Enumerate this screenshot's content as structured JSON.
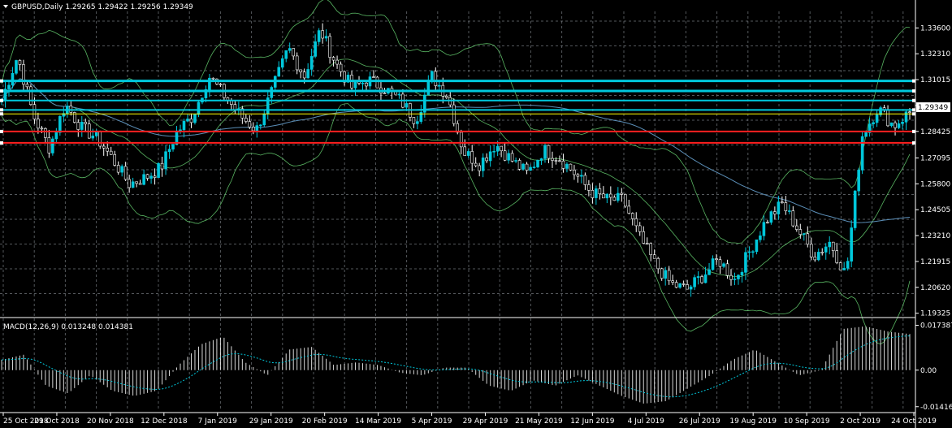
{
  "chart_data": {
    "type": "candlestick",
    "symbol": "GBPUSD,Daily",
    "ohlc_header": "1.29265 1.29422 1.29256 1.29349",
    "current_price": "1.29349",
    "price_axis_ticks": [
      "1.33600",
      "1.32310",
      "1.31015",
      "1.29720",
      "1.28425",
      "1.27095",
      "1.25800",
      "1.24505",
      "1.23210",
      "1.21915",
      "1.20620",
      "1.19325"
    ],
    "price_range": [
      1.1923,
      1.3435
    ],
    "date_labels": [
      "25 Oct 2018",
      "29 Oct 2018",
      "20 Nov 2018",
      "12 Dec 2018",
      "7 Jan 2019",
      "29 Jan 2019",
      "20 Feb 2019",
      "14 Mar 2019",
      "5 Apr 2019",
      "29 Apr 2019",
      "21 May 2019",
      "12 Jun 2019",
      "4 Jul 2019",
      "26 Jul 2019",
      "19 Aug 2019",
      "10 Sep 2019",
      "2 Oct 2019",
      "24 Oct 2019"
    ],
    "price_path": [
      1.3,
      1.322,
      1.292,
      1.276,
      1.298,
      1.286,
      1.281,
      1.27,
      1.258,
      1.261,
      1.266,
      1.284,
      1.292,
      1.312,
      1.302,
      1.292,
      1.285,
      1.305,
      1.326,
      1.312,
      1.335,
      1.318,
      1.306,
      1.31,
      1.306,
      1.3,
      1.29,
      1.312,
      1.302,
      1.274,
      1.268,
      1.278,
      1.27,
      1.263,
      1.275,
      1.271,
      1.263,
      1.254,
      1.25,
      1.25,
      1.232,
      1.218,
      1.208,
      1.205,
      1.212,
      1.22,
      1.21,
      1.225,
      1.24,
      1.248,
      1.235,
      1.222,
      1.229,
      1.212,
      1.282,
      1.296,
      1.287,
      1.294
    ],
    "horizontal_levels": [
      {
        "price": 1.3095,
        "color": "#00c8dc",
        "width": 3
      },
      {
        "price": 1.3045,
        "color": "#00c8dc",
        "width": 3
      },
      {
        "price": 1.2997,
        "color": "#00c8dc",
        "width": 2
      },
      {
        "price": 1.295,
        "color": "#00c8dc",
        "width": 2
      },
      {
        "price": 1.293,
        "color": "#ffff00",
        "width": 1
      },
      {
        "price": 1.2842,
        "color": "#ff2020",
        "width": 2
      },
      {
        "price": 1.2785,
        "color": "#ff2020",
        "width": 2
      }
    ],
    "indicators": {
      "bollinger": "bands (green)",
      "moving_average": "line (steel blue)"
    },
    "macd": {
      "label": "MACD(12,26,9) 0.013248 0.014381",
      "axis_ticks": [
        "0.017387",
        "0.00",
        "-0.014165"
      ],
      "range": [
        -0.0155,
        0.0185
      ],
      "path": [
        0.004,
        0.006,
        -0.006,
        -0.009,
        -0.002,
        -0.008,
        -0.01,
        -0.008,
        0.002,
        0.01,
        0.013,
        0.003,
        -0.002,
        0.008,
        0.009,
        0.002,
        0.003,
        0.002,
        -0.001,
        -0.002,
        0.001,
        0.001,
        -0.006,
        -0.008,
        -0.004,
        -0.006,
        -0.002,
        -0.006,
        -0.01,
        -0.013,
        -0.012,
        -0.007,
        -0.002,
        0.004,
        0.008,
        0.003,
        -0.002,
        0.0,
        0.016,
        0.017,
        0.015,
        0.014
      ]
    },
    "grid": true,
    "colors": {
      "background": "#000000",
      "grid": "#9aa0a8",
      "bull": "#00c8dc",
      "bear": "#ffffff",
      "bands": "#6fe27a",
      "ma": "#5b8fb8",
      "current_price_tag": "#ffffff"
    }
  }
}
